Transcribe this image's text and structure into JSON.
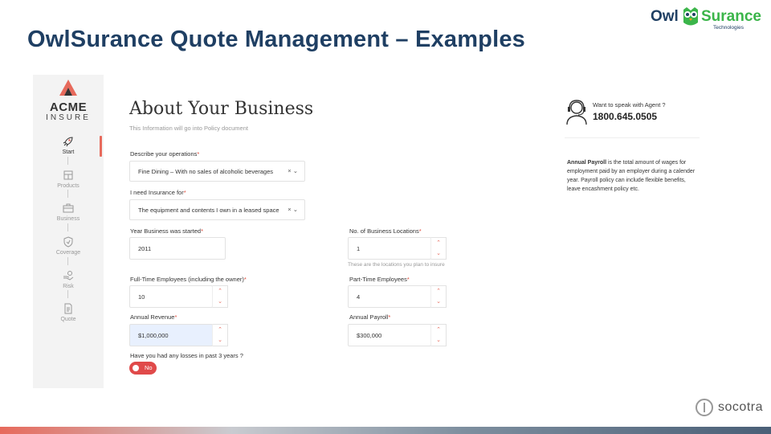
{
  "slide": {
    "title": "OwlSurance Quote Management  – Examples",
    "brand_left": "Owl",
    "brand_right": "Surance",
    "brand_tag": "Technologies",
    "footer_brand": "socotra"
  },
  "sidebar": {
    "logo_name": "ACME",
    "logo_sub": "INSURE",
    "items": [
      {
        "label": "Start",
        "icon": "rocket-icon",
        "active": true
      },
      {
        "label": "Products",
        "icon": "cube-icon",
        "active": false
      },
      {
        "label": "Business",
        "icon": "briefcase-icon",
        "active": false
      },
      {
        "label": "Coverage",
        "icon": "shield-icon",
        "active": false
      },
      {
        "label": "Risk",
        "icon": "hand-coin-icon",
        "active": false
      },
      {
        "label": "Quote",
        "icon": "document-icon",
        "active": false
      }
    ]
  },
  "form": {
    "title": "About Your Business",
    "subtitle": "This Information will go into Policy document",
    "operations": {
      "label": "Describe your operations",
      "value": "Fine Dining – With no sales of alcoholic beverages"
    },
    "insurance_for": {
      "label": "I need Insurance for",
      "value": "The equipment and contents I own in a leased space"
    },
    "year_started": {
      "label": "Year Business was started",
      "value": "2011"
    },
    "locations": {
      "label": "No. of Business Locations",
      "value": "1",
      "hint": "These are the locations you plan to insure"
    },
    "full_time": {
      "label": "Full-Time Employees (including the owner)",
      "value": "10"
    },
    "part_time": {
      "label": "Part-Time Employees",
      "value": "4"
    },
    "revenue": {
      "label": "Annual Revenue",
      "value": "$1,000,000"
    },
    "payroll": {
      "label": "Annual Payroll",
      "value": "$300,000"
    },
    "losses": {
      "label": "Have you had any losses in past 3 years ?",
      "value": "No"
    },
    "req_mark": "*",
    "select_controls": "× ⌄",
    "stepper_up": "⌃",
    "stepper_down": "⌄"
  },
  "agent": {
    "question": "Want to speak with Agent ?",
    "phone": "1800.645.0505"
  },
  "help": {
    "term": "Annual Payroll",
    "text": " is the total amount of wages for employment paid by an employer during a calender year. Payroll policy can include flexible benefits, leave encashment policy etc."
  },
  "colors": {
    "accent": "#e76a5c",
    "title": "#1f3f63",
    "brand_green": "#3bb54a",
    "toggle": "#e04a4a"
  }
}
